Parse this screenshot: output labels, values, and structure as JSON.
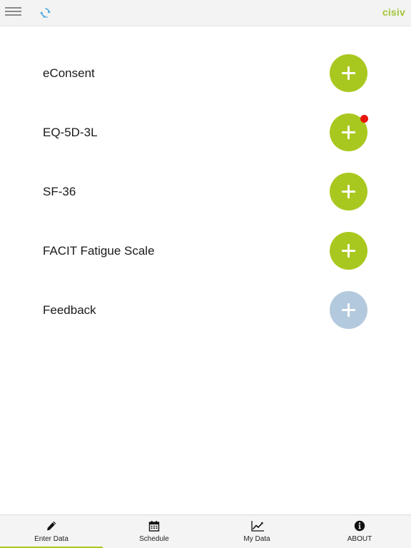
{
  "header": {
    "brand": "cisiv",
    "menu_icon": "hamburger-menu-icon",
    "sync_icon": "sync-icon"
  },
  "colors": {
    "accent": "#a9c81f",
    "disabled": "#b3c9dd",
    "notification": "#e8150c",
    "brand": "#a4c638"
  },
  "list": {
    "items": [
      {
        "label": "eConsent",
        "enabled": true,
        "notification": false
      },
      {
        "label": "EQ-5D-3L",
        "enabled": true,
        "notification": true
      },
      {
        "label": "SF-36",
        "enabled": true,
        "notification": false
      },
      {
        "label": "FACIT Fatigue Scale",
        "enabled": true,
        "notification": false
      },
      {
        "label": "Feedback",
        "enabled": false,
        "notification": false
      }
    ]
  },
  "tabs": [
    {
      "label": "Enter Data",
      "icon": "pencil-icon",
      "active": true
    },
    {
      "label": "Schedule",
      "icon": "calendar-icon",
      "active": false
    },
    {
      "label": "My Data",
      "icon": "line-chart-icon",
      "active": false
    },
    {
      "label": "ABOUT",
      "icon": "info-icon",
      "active": false
    }
  ]
}
